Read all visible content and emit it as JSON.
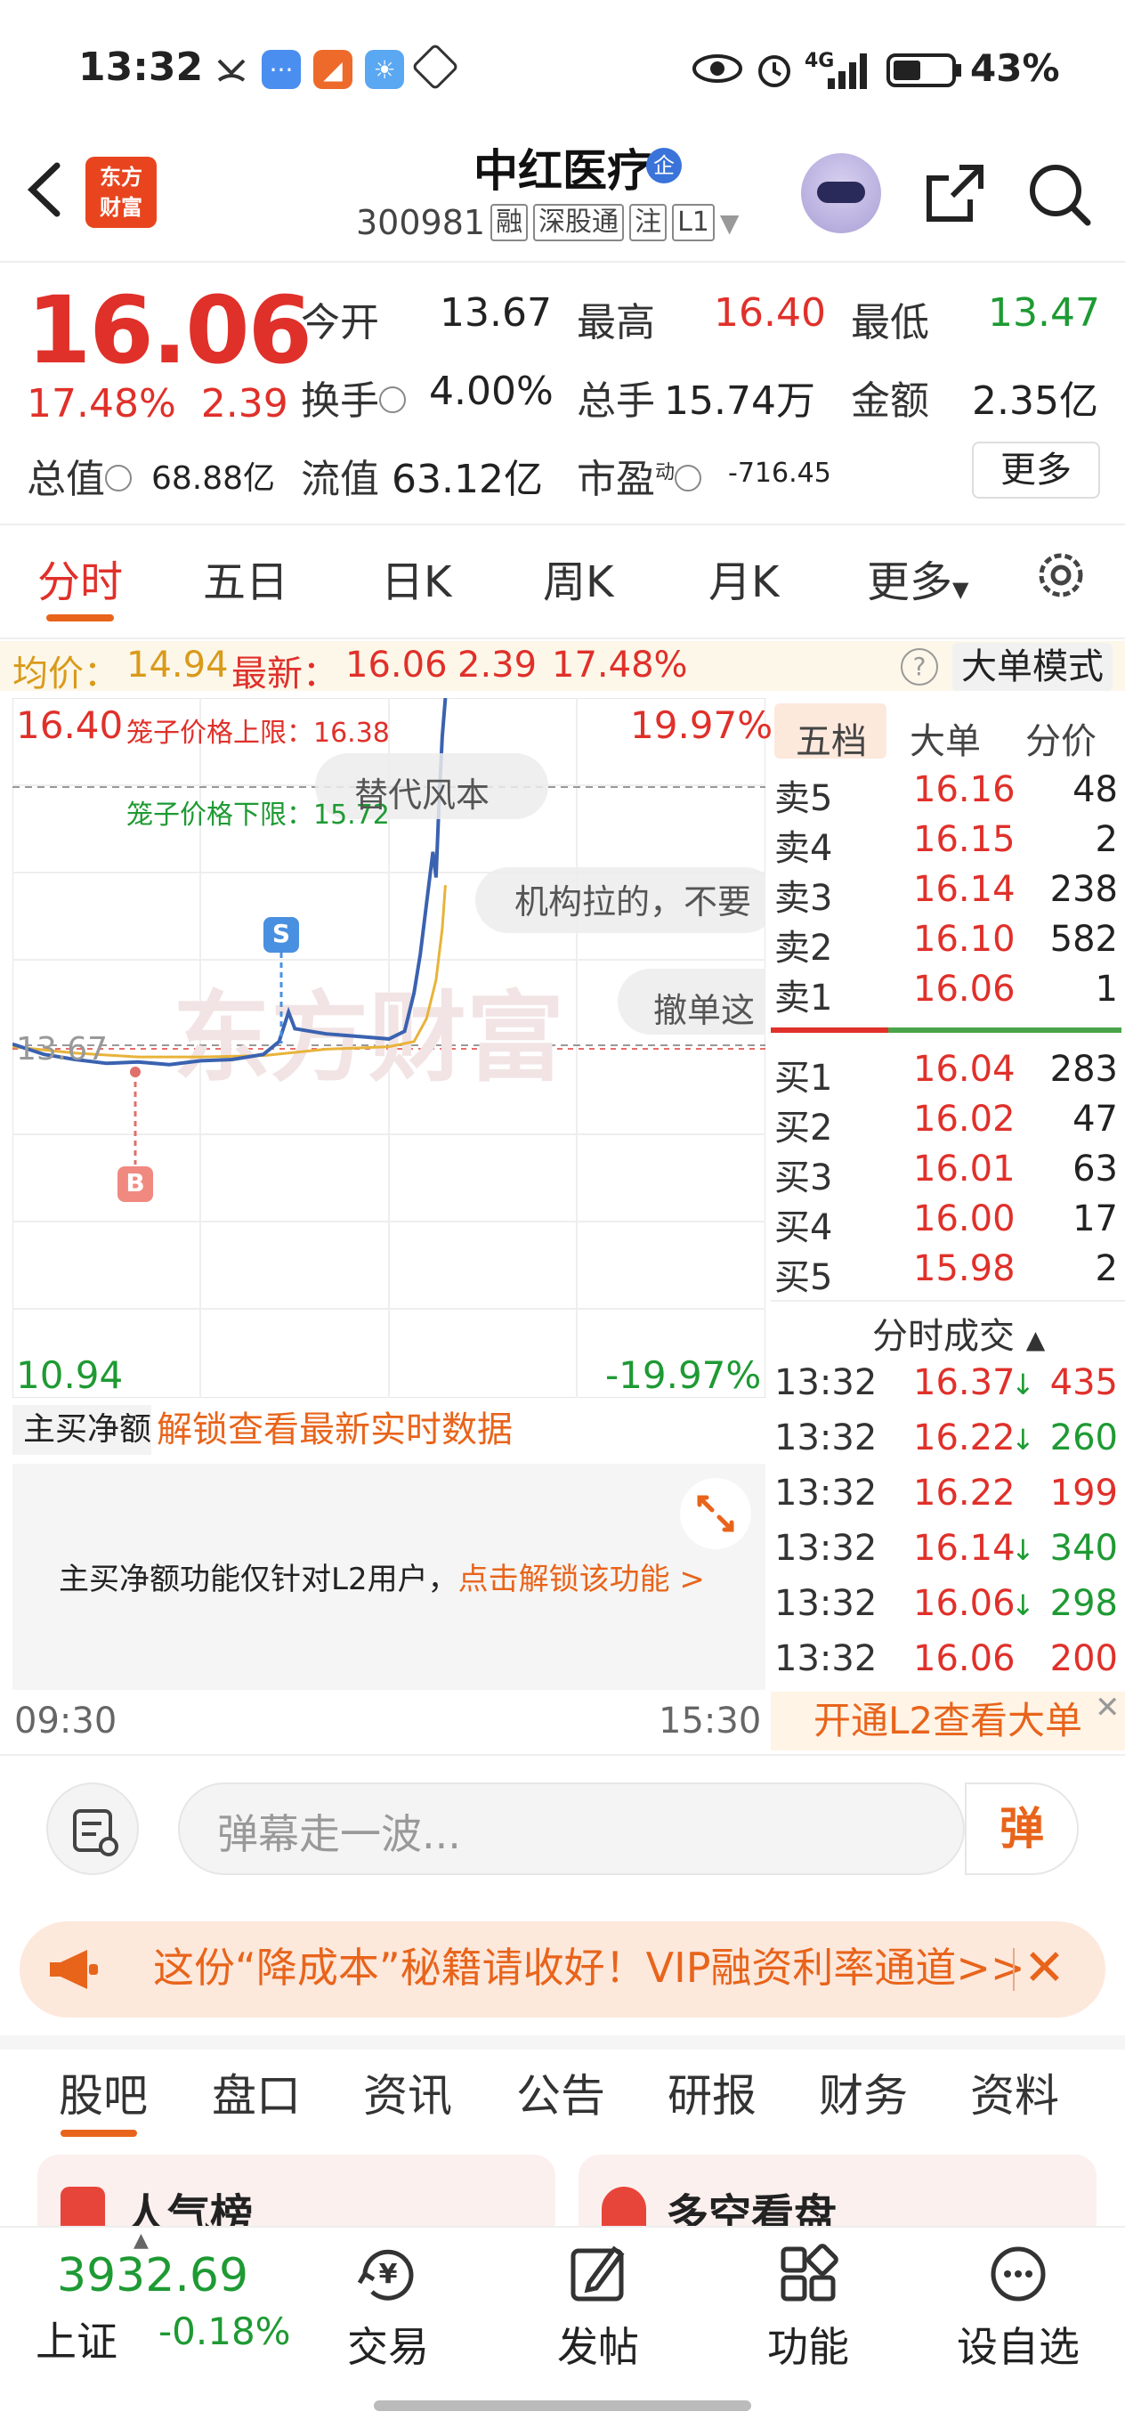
{
  "status_bar": {
    "time": "13:32",
    "network": "4G",
    "battery": "43%"
  },
  "header": {
    "stock_name": "中红医疗",
    "qi_badge": "企",
    "code": "300981",
    "tags": [
      "融",
      "深股通",
      "注",
      "L1"
    ]
  },
  "quote": {
    "price": "16.06",
    "change_pct": "17.48%",
    "change": "2.39",
    "open_label": "今开",
    "open": "13.67",
    "high_label": "最高",
    "high": "16.40",
    "low_label": "最低",
    "low": "13.47",
    "turnover_label": "换手",
    "turnover": "4.00%",
    "volume_label": "总手",
    "volume": "15.74万",
    "amount_label": "金额",
    "amount": "2.35亿",
    "mktcap_label": "总值",
    "mktcap": "68.88亿",
    "float_label": "流值",
    "float_cap": "63.12亿",
    "pe_label": "市盈",
    "pe_sup": "动",
    "pe": "-716.45",
    "more_label": "更多"
  },
  "period_tabs": [
    "分时",
    "五日",
    "日K",
    "周K",
    "月K",
    "更多"
  ],
  "avg_row": {
    "avg_label": "均价：",
    "avg": "14.94",
    "latest_label": "最新：",
    "latest": "16.06",
    "chg": "2.39",
    "pct": "17.48%",
    "help": "?",
    "mode_button": "大单模式"
  },
  "chart": {
    "top_price": "16.40",
    "top_pct": "19.97%",
    "bottom_price": "10.94",
    "bottom_pct": "-19.97%",
    "prev_close": "13.67",
    "cage_upper": "笼子价格上限：16.38",
    "cage_lower": "笼子价格下限：15.72",
    "watermark": "东方财富",
    "danmaku": [
      "替代风本",
      "机构拉的，不要",
      "撤单这"
    ],
    "marker_s": "S",
    "marker_b": "B",
    "time_start": "09:30",
    "time_end": "15:30",
    "ylim": [
      10.94,
      16.4
    ],
    "price_line_color": "#3a62b0",
    "avg_line_color": "#e8b33a"
  },
  "order_book": {
    "tabs": [
      "五档",
      "大单",
      "分价"
    ],
    "asks": [
      {
        "label": "卖5",
        "price": "16.16",
        "vol": "48"
      },
      {
        "label": "卖4",
        "price": "16.15",
        "vol": "2"
      },
      {
        "label": "卖3",
        "price": "16.14",
        "vol": "238"
      },
      {
        "label": "卖2",
        "price": "16.10",
        "vol": "582"
      },
      {
        "label": "卖1",
        "price": "16.06",
        "vol": "1"
      }
    ],
    "bids": [
      {
        "label": "买1",
        "price": "16.04",
        "vol": "283"
      },
      {
        "label": "买2",
        "price": "16.02",
        "vol": "47"
      },
      {
        "label": "买3",
        "price": "16.01",
        "vol": "63"
      },
      {
        "label": "买4",
        "price": "16.00",
        "vol": "17"
      },
      {
        "label": "买5",
        "price": "15.98",
        "vol": "2"
      }
    ],
    "trades_title": "分时成交",
    "trades": [
      {
        "time": "13:32",
        "price": "16.37",
        "dir": "↓",
        "vol": "435",
        "color": "red"
      },
      {
        "time": "13:32",
        "price": "16.22",
        "dir": "↓",
        "vol": "260",
        "color": "green"
      },
      {
        "time": "13:32",
        "price": "16.22",
        "dir": "",
        "vol": "199",
        "color": "red"
      },
      {
        "time": "13:32",
        "price": "16.14",
        "dir": "↓",
        "vol": "340",
        "color": "green"
      },
      {
        "time": "13:32",
        "price": "16.06",
        "dir": "↓",
        "vol": "298",
        "color": "green"
      },
      {
        "time": "13:32",
        "price": "16.06",
        "dir": "",
        "vol": "200",
        "color": "red"
      }
    ],
    "l2_button": "开通L2查看大单"
  },
  "netflow": {
    "dropdown": "主买净额",
    "unlock": "解锁查看最新实时数据",
    "panel_text": "主买净额功能仅针对L2用户，",
    "panel_link": "点击解锁该功能 >"
  },
  "danmaku_input": {
    "placeholder": "弹幕走一波...",
    "send": "弹"
  },
  "promo": {
    "text": "这份“降成本”秘籍请收好！VIP融资利率通道>>"
  },
  "section_tabs": [
    "股吧",
    "盘口",
    "资讯",
    "公告",
    "研报",
    "财务",
    "资料"
  ],
  "cards": [
    "人气榜",
    "多空看盘"
  ],
  "bottom_nav": {
    "index_value": "3932.69",
    "index_name": "上证",
    "index_change": "-0.18%",
    "items": [
      "交易",
      "发帖",
      "功能",
      "设自选"
    ]
  }
}
